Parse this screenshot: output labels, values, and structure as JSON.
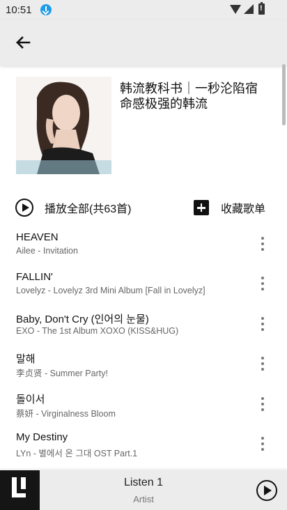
{
  "status": {
    "time": "10:51"
  },
  "toolbar": {
    "back_icon": "arrow-left-icon"
  },
  "playlist": {
    "title": "韩流教科书｜一秒沦陷宿命感极强的韩流",
    "play_all_label": "播放全部(共63首)",
    "collect_label": "收藏歌单"
  },
  "songs": [
    {
      "title": "HEAVEN",
      "subtitle": "Ailee - Invitation"
    },
    {
      "title": "FALLIN'",
      "subtitle": "Lovelyz - Lovelyz 3rd Mini Album [Fall in Lovelyz]"
    },
    {
      "title": "Baby, Don't Cry (인어의 눈물)",
      "subtitle": "EXO - The 1st Album XOXO (KISS&HUG)"
    },
    {
      "title": "말해",
      "subtitle": "李贞贤 - Summer Party!"
    },
    {
      "title": "돌이서",
      "subtitle": "蔡妍 - Virginalness Bloom"
    },
    {
      "title": "My Destiny",
      "subtitle": "LYn - 별에서 온 그대 OST Part.1"
    }
  ],
  "player": {
    "title": "Listen 1",
    "artist": "Artist"
  }
}
